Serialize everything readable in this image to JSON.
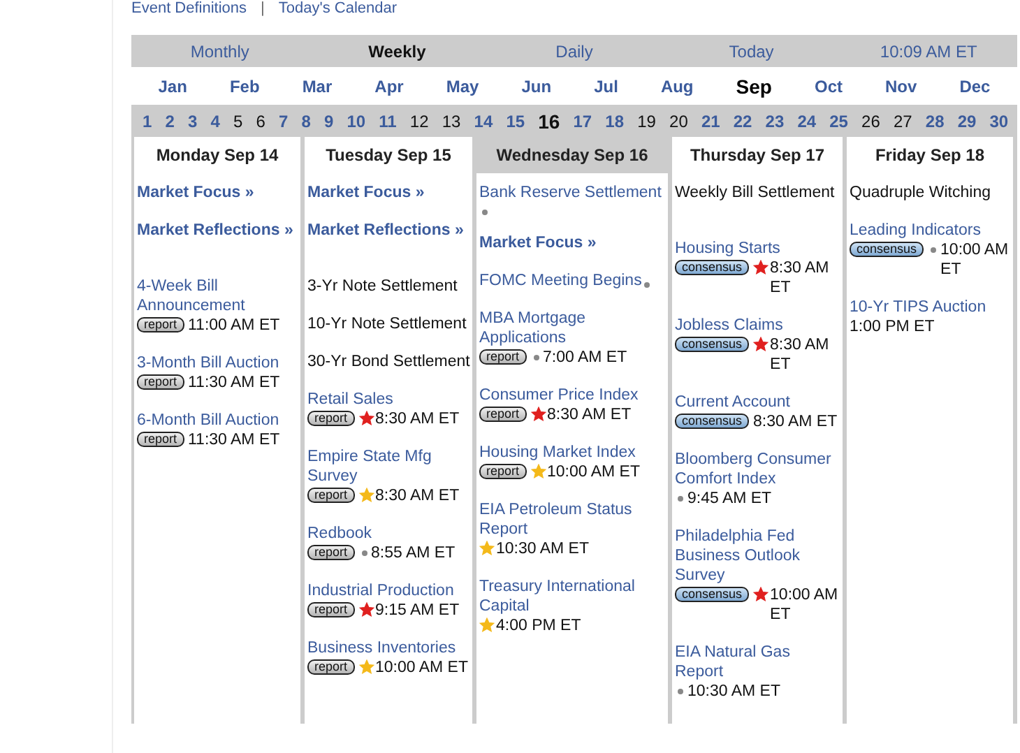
{
  "top_links": [
    "Event Definitions",
    "Today's Calendar"
  ],
  "top_separator": "|",
  "nav": [
    {
      "label": "Monthly",
      "selected": false
    },
    {
      "label": "Weekly",
      "selected": true
    },
    {
      "label": "Daily",
      "selected": false
    },
    {
      "label": "Today",
      "selected": false
    },
    {
      "label": "10:09 AM ET",
      "selected": false
    }
  ],
  "months": [
    {
      "label": "Jan",
      "selected": false
    },
    {
      "label": "Feb",
      "selected": false
    },
    {
      "label": "Mar",
      "selected": false
    },
    {
      "label": "Apr",
      "selected": false
    },
    {
      "label": "May",
      "selected": false
    },
    {
      "label": "Jun",
      "selected": false
    },
    {
      "label": "Jul",
      "selected": false
    },
    {
      "label": "Aug",
      "selected": false
    },
    {
      "label": "Sep",
      "selected": true
    },
    {
      "label": "Oct",
      "selected": false
    },
    {
      "label": "Nov",
      "selected": false
    },
    {
      "label": "Dec",
      "selected": false
    }
  ],
  "days": [
    {
      "label": "1",
      "link": true,
      "selected": false
    },
    {
      "label": "2",
      "link": true,
      "selected": false
    },
    {
      "label": "3",
      "link": true,
      "selected": false
    },
    {
      "label": "4",
      "link": true,
      "selected": false
    },
    {
      "label": "5",
      "link": false,
      "selected": false
    },
    {
      "label": "6",
      "link": false,
      "selected": false
    },
    {
      "label": "7",
      "link": true,
      "selected": false
    },
    {
      "label": "8",
      "link": true,
      "selected": false
    },
    {
      "label": "9",
      "link": true,
      "selected": false
    },
    {
      "label": "10",
      "link": true,
      "selected": false
    },
    {
      "label": "11",
      "link": true,
      "selected": false
    },
    {
      "label": "12",
      "link": false,
      "selected": false
    },
    {
      "label": "13",
      "link": false,
      "selected": false
    },
    {
      "label": "14",
      "link": true,
      "selected": false
    },
    {
      "label": "15",
      "link": true,
      "selected": false
    },
    {
      "label": "16",
      "link": false,
      "selected": true
    },
    {
      "label": "17",
      "link": true,
      "selected": false
    },
    {
      "label": "18",
      "link": true,
      "selected": false
    },
    {
      "label": "19",
      "link": false,
      "selected": false
    },
    {
      "label": "20",
      "link": false,
      "selected": false
    },
    {
      "label": "21",
      "link": true,
      "selected": false
    },
    {
      "label": "22",
      "link": true,
      "selected": false
    },
    {
      "label": "23",
      "link": true,
      "selected": false
    },
    {
      "label": "24",
      "link": true,
      "selected": false
    },
    {
      "label": "25",
      "link": true,
      "selected": false
    },
    {
      "label": "26",
      "link": false,
      "selected": false
    },
    {
      "label": "27",
      "link": false,
      "selected": false
    },
    {
      "label": "28",
      "link": true,
      "selected": false
    },
    {
      "label": "29",
      "link": true,
      "selected": false
    },
    {
      "label": "30",
      "link": true,
      "selected": false
    }
  ],
  "columns": [
    {
      "heading": "Monday Sep 14",
      "selected": false,
      "events": [
        {
          "kind": "focus",
          "title": "Market Focus »"
        },
        {
          "kind": "focus",
          "title": "Market Reflections »"
        },
        {
          "kind": "gap"
        },
        {
          "kind": "link",
          "title": "4-Week Bill Announcement",
          "badge": "report",
          "time": "11:00 AM ET"
        },
        {
          "kind": "link",
          "title": "3-Month Bill Auction",
          "badge": "report",
          "time": "11:30 AM ET"
        },
        {
          "kind": "link",
          "title": "6-Month Bill Auction",
          "badge": "report",
          "time": "11:30 AM ET"
        }
      ]
    },
    {
      "heading": "Tuesday Sep 15",
      "selected": false,
      "events": [
        {
          "kind": "focus",
          "title": "Market Focus »"
        },
        {
          "kind": "focus",
          "title": "Market Reflections »"
        },
        {
          "kind": "gap"
        },
        {
          "kind": "plain",
          "title": "3-Yr Note Settlement"
        },
        {
          "kind": "plain",
          "title": "10-Yr Note Settlement"
        },
        {
          "kind": "plain",
          "title": "30-Yr Bond Settlement"
        },
        {
          "kind": "link",
          "title": "Retail Sales",
          "badge": "report",
          "marker": {
            "kind": "star",
            "color": "#e0201f"
          },
          "time": "8:30 AM ET"
        },
        {
          "kind": "link",
          "title": "Empire State Mfg Survey",
          "badge": "report",
          "marker": {
            "kind": "star",
            "color": "#f4b91a"
          },
          "time": "8:30 AM ET"
        },
        {
          "kind": "link",
          "title": "Redbook",
          "badge": "report",
          "marker": {
            "kind": "dot",
            "color": "#888888"
          },
          "time": "8:55 AM ET"
        },
        {
          "kind": "link",
          "title": "Industrial Production",
          "badge": "report",
          "marker": {
            "kind": "star",
            "color": "#e0201f"
          },
          "time": "9:15 AM ET"
        },
        {
          "kind": "link",
          "title": "Business Inventories",
          "badge": "report",
          "marker": {
            "kind": "star",
            "color": "#f4b91a"
          },
          "time": "10:00 AM ET"
        }
      ]
    },
    {
      "heading": "Wednesday Sep 16",
      "selected": true,
      "events": [
        {
          "kind": "link",
          "title": "Bank Reserve Settlement",
          "marker": {
            "kind": "dot",
            "color": "#888888"
          }
        },
        {
          "kind": "focus",
          "title": "Market Focus »"
        },
        {
          "kind": "link",
          "title": "FOMC Meeting Begins",
          "marker": {
            "kind": "dot",
            "color": "#888888"
          }
        },
        {
          "kind": "link",
          "title": "MBA Mortgage Applications",
          "badge": "report",
          "marker": {
            "kind": "dot",
            "color": "#888888"
          },
          "time": "7:00 AM ET"
        },
        {
          "kind": "link",
          "title": "Consumer Price Index",
          "badge": "report",
          "marker": {
            "kind": "star",
            "color": "#e0201f"
          },
          "time": "8:30 AM ET"
        },
        {
          "kind": "link",
          "title": "Housing Market Index",
          "badge": "report",
          "marker": {
            "kind": "star",
            "color": "#f4b91a"
          },
          "time": "10:00 AM ET"
        },
        {
          "kind": "link",
          "title": "EIA Petroleum Status Report",
          "marker": {
            "kind": "star",
            "color": "#f4b91a"
          },
          "time": "10:30 AM ET"
        },
        {
          "kind": "link",
          "title": "Treasury International Capital",
          "marker": {
            "kind": "star",
            "color": "#f4b91a"
          },
          "time": "4:00 PM ET"
        }
      ]
    },
    {
      "heading": "Thursday Sep 17",
      "selected": false,
      "events": [
        {
          "kind": "plain",
          "title": "Weekly Bill Settlement"
        },
        {
          "kind": "gap"
        },
        {
          "kind": "link",
          "title": "Housing Starts",
          "badge": "consensus",
          "marker": {
            "kind": "star",
            "color": "#e0201f"
          },
          "time": "8:30 AM ET"
        },
        {
          "kind": "link",
          "title": "Jobless Claims",
          "badge": "consensus",
          "marker": {
            "kind": "star",
            "color": "#e0201f"
          },
          "time": "8:30 AM ET"
        },
        {
          "kind": "link",
          "title": "Current Account",
          "badge": "consensus",
          "time": "8:30 AM ET"
        },
        {
          "kind": "link",
          "title": "Bloomberg Consumer Comfort Index",
          "marker": {
            "kind": "dot",
            "color": "#888888"
          },
          "time": "9:45 AM ET"
        },
        {
          "kind": "link",
          "title": "Philadelphia Fed Business Outlook Survey",
          "badge": "consensus",
          "marker": {
            "kind": "star",
            "color": "#e0201f"
          },
          "time": "10:00 AM ET"
        },
        {
          "kind": "link",
          "title": "EIA Natural Gas Report",
          "marker": {
            "kind": "dot",
            "color": "#888888"
          },
          "time": "10:30 AM ET"
        }
      ]
    },
    {
      "heading": "Friday Sep 18",
      "selected": false,
      "events": [
        {
          "kind": "plain",
          "title": "Quadruple Witching"
        },
        {
          "kind": "link",
          "title": "Leading Indicators",
          "badge": "consensus",
          "marker": {
            "kind": "dot",
            "color": "#888888"
          },
          "time": "10:00 AM ET"
        },
        {
          "kind": "link",
          "title": "10-Yr TIPS Auction",
          "time": "1:00 PM ET"
        }
      ]
    }
  ]
}
